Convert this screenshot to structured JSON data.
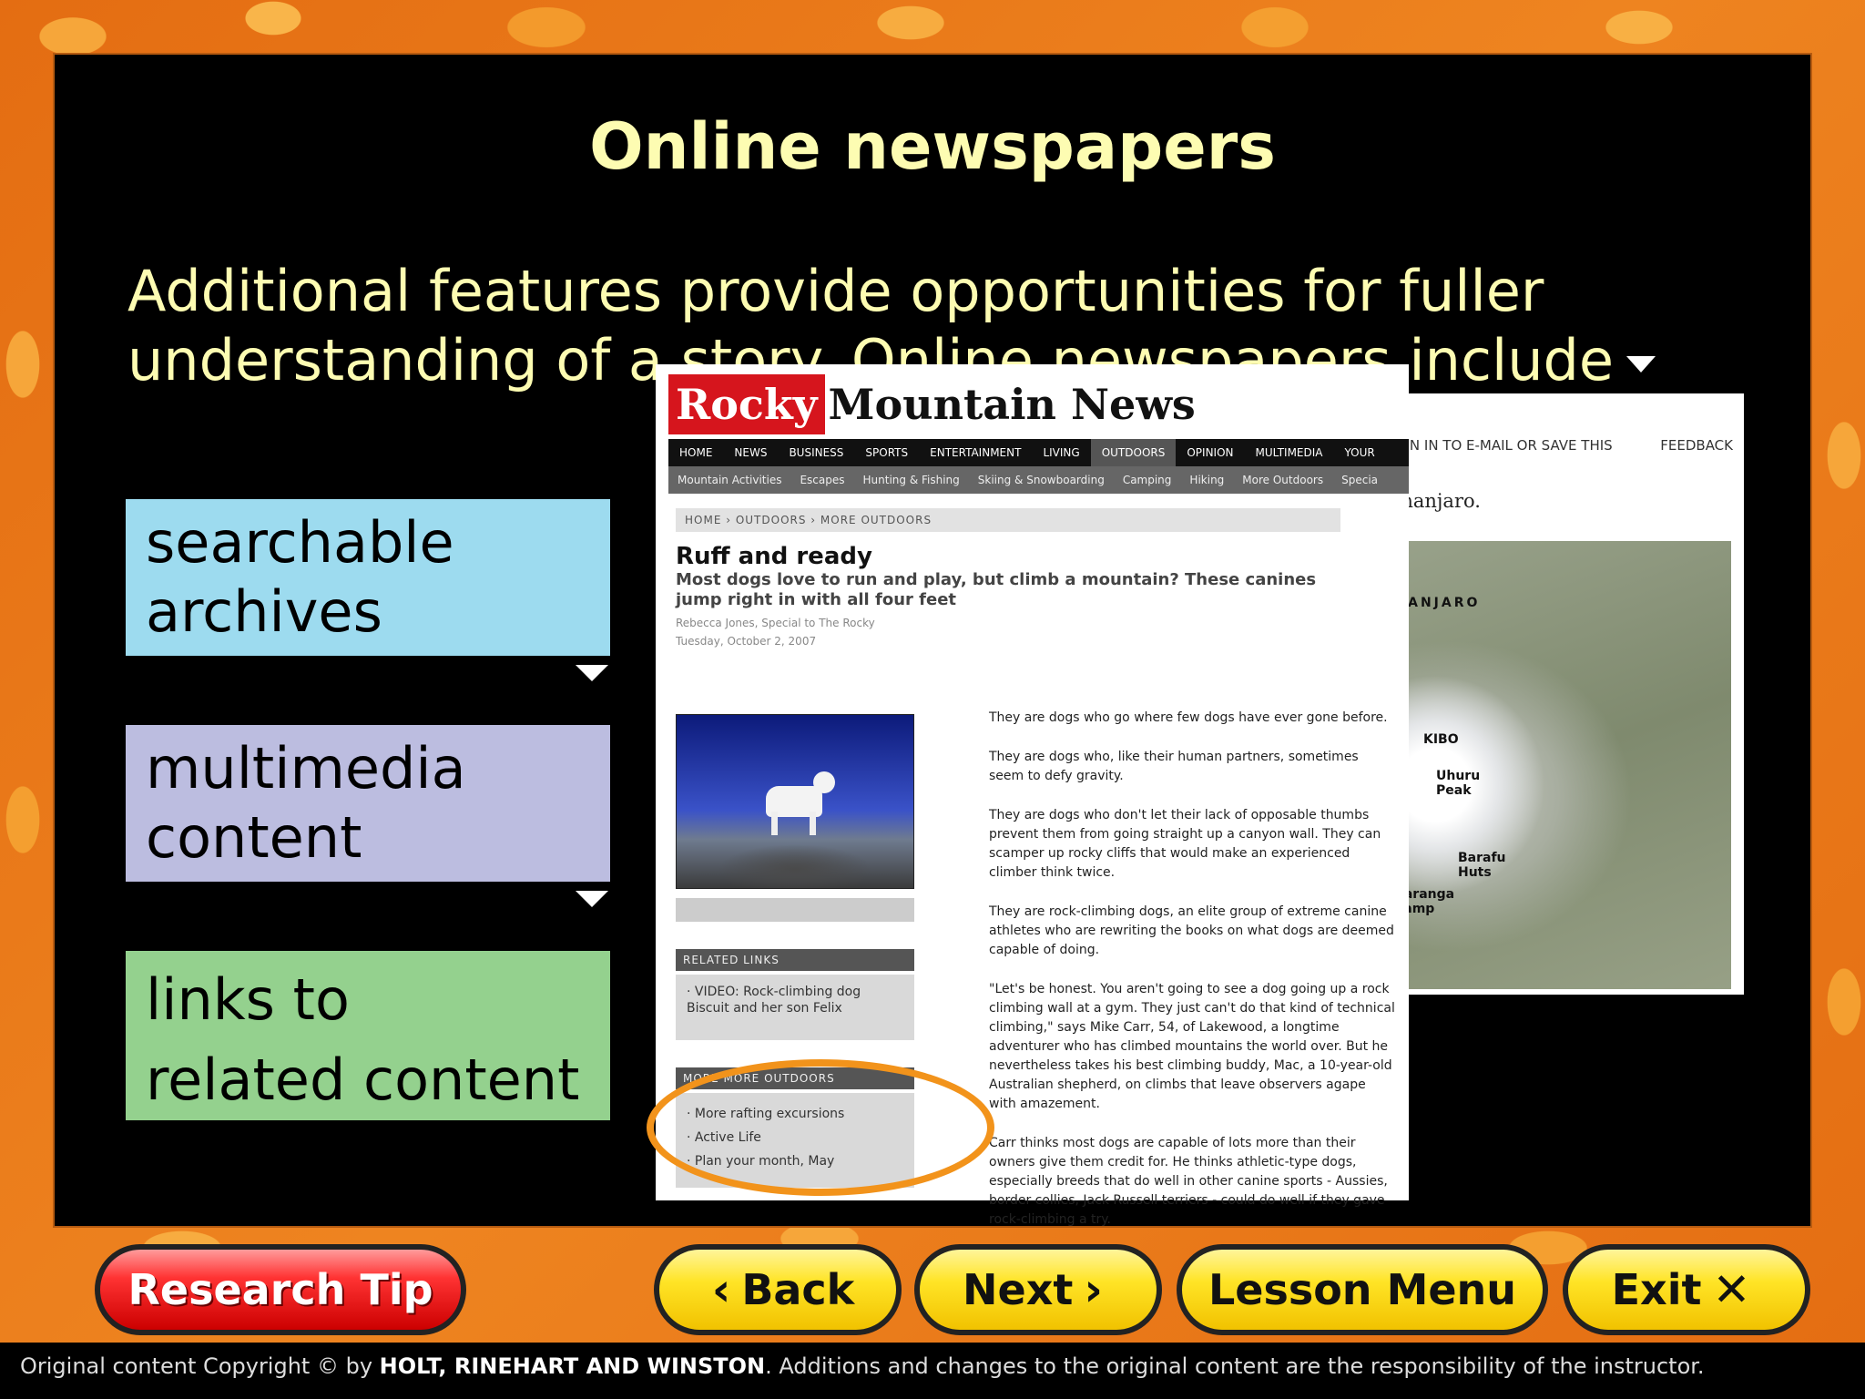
{
  "slide": {
    "title": "Online newspapers",
    "intro": "Additional features provide opportunities for fuller understanding of a story. Online newspapers include",
    "features": [
      {
        "label_line1": "searchable",
        "label_line2": "archives",
        "color": "#9ddbef"
      },
      {
        "label_line1": "multimedia",
        "label_line2": "content",
        "color": "#bcbde0"
      },
      {
        "label_line1": "links to",
        "label_line2": "related content",
        "color": "#94d18e"
      }
    ]
  },
  "webpage": {
    "logo_red": "Rocky",
    "logo_black": "Mountain News",
    "nav_primary": [
      "HOME",
      "NEWS",
      "BUSINESS",
      "SPORTS",
      "ENTERTAINMENT",
      "LIVING",
      "OUTDOORS",
      "OPINION",
      "MULTIMEDIA",
      "YOUR"
    ],
    "nav_active": "OUTDOORS",
    "nav_secondary": [
      "Mountain Activities",
      "Escapes",
      "Hunting & Fishing",
      "Skiing & Snowboarding",
      "Camping",
      "Hiking",
      "More Outdoors",
      "Specia"
    ],
    "breadcrumb": "HOME › OUTDOORS › MORE OUTDOORS",
    "headline": "Ruff and ready",
    "deck": "Most dogs love to run and play, but climb a mountain? These canines jump right in with all four feet",
    "author": "Rebecca Jones, Special to The Rocky",
    "date": "Tuesday, October 2, 2007",
    "related_links_header": "RELATED LINKS",
    "related_links": [
      "· VIDEO: Rock-climbing dog Biscuit and her son Felix"
    ],
    "more_header": "MORE MORE OUTDOORS",
    "more_links": [
      "· More rafting excursions",
      "· Active Life",
      "· Plan your month, May"
    ],
    "paragraphs": [
      "They are dogs who go where few dogs have ever gone before.",
      "They are dogs who, like their human partners, sometimes seem to defy gravity.",
      "They are dogs who don't let their lack of opposable thumbs prevent them from going straight up a canyon wall. They can scamper up rocky cliffs that would make an experienced climber think twice.",
      "They are rock-climbing dogs, an elite group of extreme canine athletes who are rewriting the books on what dogs are deemed capable of doing.",
      "\"Let's be honest. You aren't going to see a dog going up a rock climbing wall at a gym. They just can't do that kind of technical climbing,\" says Mike Carr, 54, of Lakewood, a longtime adventurer who has climbed mountains the world over. But he nevertheless takes his best climbing buddy, Mac, a 10-year-old Australian shepherd, on climbs that leave observers agape with amazement.",
      "Carr thinks most dogs are capable of lots more than their owners give them credit for. He thinks athletic-type dogs, especially breeds that do well in other canine sports - Aussies, border collies, Jack Russell terriers - could do well if they gave rock-climbing a try."
    ],
    "back_page": {
      "sign_in": "✉ SIGN IN TO E-MAIL OR SAVE THIS",
      "feedback": "FEEDBACK",
      "text": "t Kilimanjaro.",
      "map_labels": [
        "KILIMANJARO",
        "KIBO",
        "Uhuru Peak",
        "Barafu Huts",
        "Karanga Camp"
      ]
    }
  },
  "buttons": {
    "research_tip": "Research Tip",
    "back": "Back",
    "next": "Next",
    "lesson_menu": "Lesson Menu",
    "exit": "Exit"
  },
  "footer": {
    "prefix": "Original content Copyright © by ",
    "publisher": "HOLT, RINEHART AND WINSTON",
    "suffix": ". Additions and changes to the original content are the responsibility of the instructor."
  }
}
